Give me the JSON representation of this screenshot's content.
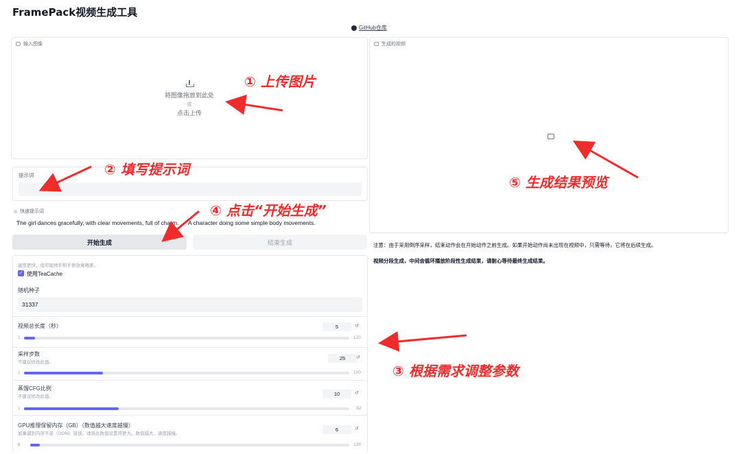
{
  "app": {
    "title": "FramePack视频生成工具",
    "github": "GitHub仓库"
  },
  "input_image": {
    "label": "输入图像",
    "drop_text": "将图像拖放到此处",
    "or_text": "- 或 -",
    "click_text": "点击上传"
  },
  "output_video": {
    "label": "生成的视频"
  },
  "prompt": {
    "label": "提示词",
    "value": ""
  },
  "quick_prompts": {
    "label": "快速提示词",
    "items": [
      "The girl dances gracefully, with clear movements, full of charm.",
      "A character doing some simple body movements."
    ]
  },
  "buttons": {
    "start": "开始生成",
    "end": "结束生成"
  },
  "notes": {
    "line1": "注意：由于采用倒序采样，结束动作会在开始动作之前生成。如果开始动作尚未出现在视频中，只需等待，它将在后续生成。",
    "line2": "视频分段生成，中间会循环播放阶段性生成结果，请耐心等待最终生成结果。"
  },
  "params": {
    "hint_top": "速度更快，但可能稍手和手势效果略差。",
    "teacache": {
      "label": "使用TeaCache",
      "checked": true
    },
    "seed": {
      "label": "随机种子",
      "value": "31337"
    },
    "sliders": [
      {
        "label": "视频总长度（秒）",
        "sub": "",
        "value": 5,
        "min": 1,
        "max": 120,
        "value_text": "5",
        "min_text": "1",
        "max_text": "120"
      },
      {
        "label": "采样步数",
        "sub": "不建议修改此值。",
        "value": 25,
        "min": 1,
        "max": 100,
        "value_text": "25",
        "min_text": "1",
        "max_text": "100"
      },
      {
        "label": "蒸馏CFG比例",
        "sub": "不建议修改此值。",
        "value": 10,
        "min": 1,
        "max": 32,
        "value_text": "10",
        "min_text": "1",
        "max_text": "32"
      },
      {
        "label": "GPU推理保留内存（GB）（数值越大速度越慢）",
        "sub": "如果遇到内存不足（OOM）错误，请将此数值设置得更大。数值越大，速度越慢。",
        "value": 6,
        "min": 6,
        "max": 128,
        "value_text": "6",
        "min_text": "6",
        "max_text": "128"
      }
    ],
    "reset_icon": "reset-icon"
  },
  "annotations": {
    "a1": "① 上传图片",
    "a2": "② 填写提示词",
    "a3": "③ 根据需求调整参数",
    "a4": "④ 点击“开始生成”",
    "a5": "⑤ 生成结果预览"
  },
  "colors": {
    "accent": "#6366f1",
    "annotation": "#ef2b2b"
  }
}
